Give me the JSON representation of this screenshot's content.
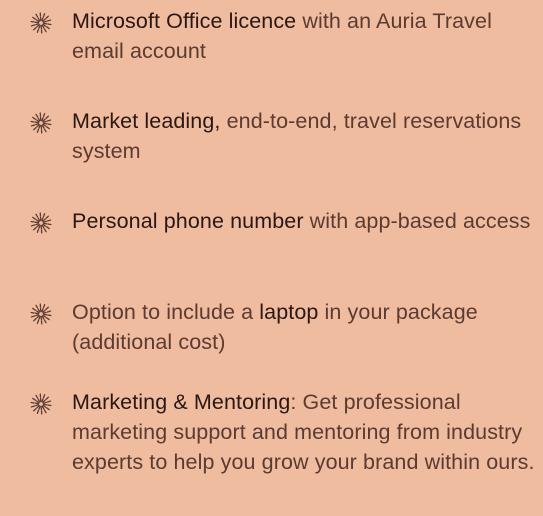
{
  "theme": {
    "background": "#efbc9f",
    "text": "#5b3b31",
    "emphasis": "#2a1713",
    "icon": "#5b3b31"
  },
  "items": [
    {
      "icon": "sparkle-burst-icon",
      "lead": "Microsoft Office licence",
      "rest": " with an Auria Travel email account"
    },
    {
      "icon": "sparkle-burst-icon",
      "lead": "Market leading,",
      "rest": " end-to-end, travel reservations system"
    },
    {
      "icon": "sparkle-burst-icon",
      "lead": "Personal phone number",
      "rest": " with app-based access"
    },
    {
      "icon": "sparkle-burst-icon",
      "pre": "Option to include a ",
      "lead": "laptop",
      "rest": " in your package (additional cost)"
    },
    {
      "icon": "sparkle-burst-icon",
      "lead": "Marketing & Mentoring",
      "rest": ": Get professional marketing support and mentoring from industry experts to help you grow your brand within ours."
    }
  ]
}
